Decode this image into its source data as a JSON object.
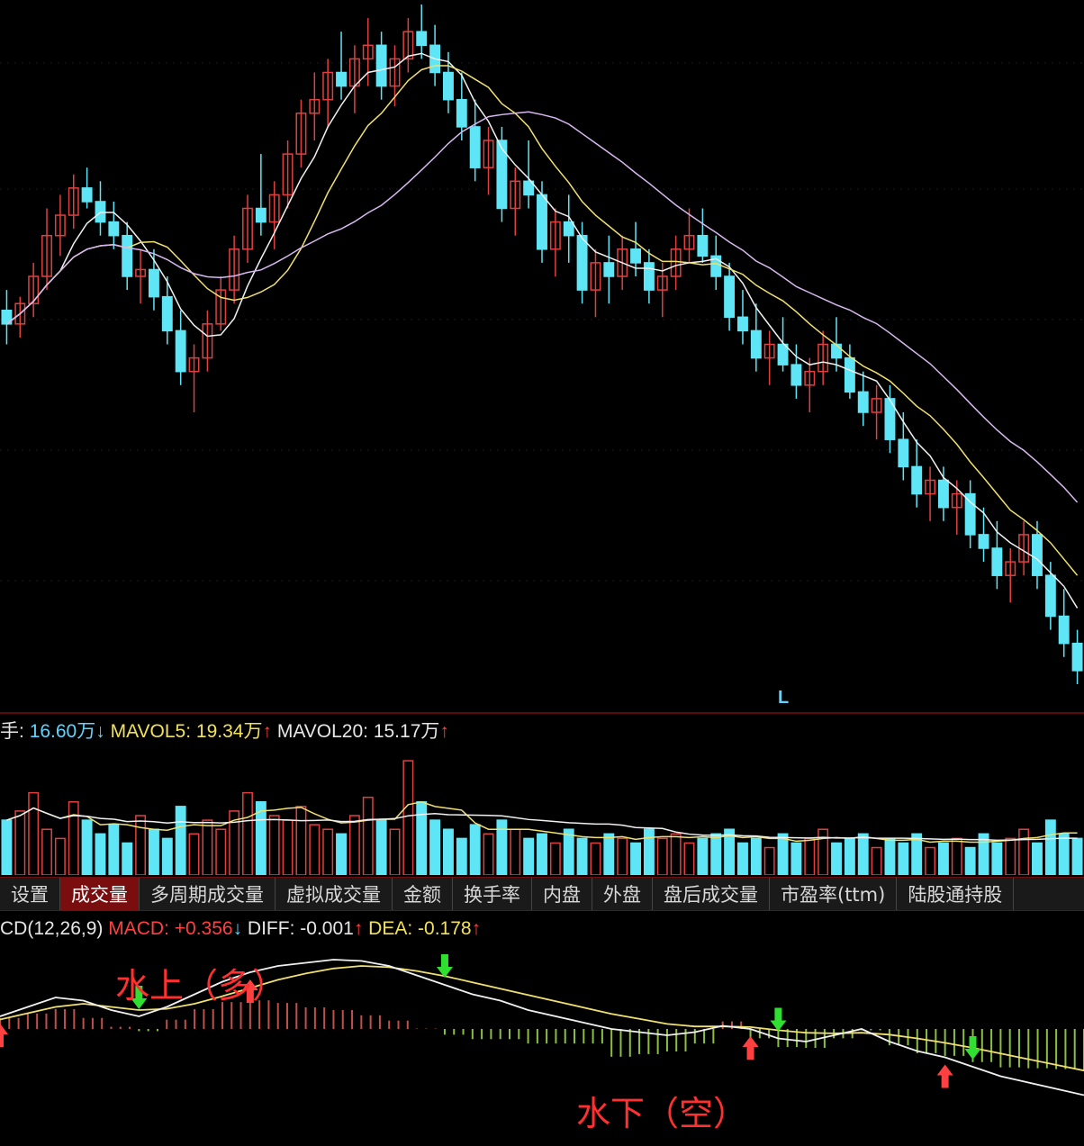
{
  "price_marker": "L",
  "volume_header": {
    "vol_label": "手:",
    "vol_value": "16.60万",
    "vol_arrow": "↓",
    "mavol5_label": "MAVOL5:",
    "mavol5_value": "19.34万",
    "mavol5_arrow": "↑",
    "mavol20_label": "MAVOL20:",
    "mavol20_value": "15.17万",
    "mavol20_arrow": "↑"
  },
  "tabs": [
    {
      "label": "设置",
      "active": false
    },
    {
      "label": "成交量",
      "active": true
    },
    {
      "label": "多周期成交量",
      "active": false
    },
    {
      "label": "虚拟成交量",
      "active": false
    },
    {
      "label": "金额",
      "active": false
    },
    {
      "label": "换手率",
      "active": false
    },
    {
      "label": "内盘",
      "active": false
    },
    {
      "label": "外盘",
      "active": false
    },
    {
      "label": "盘后成交量",
      "active": false
    },
    {
      "label": "市盈率(ttm)",
      "active": false
    },
    {
      "label": "陆股通持股",
      "active": false
    }
  ],
  "macd_header": {
    "name": "CD(12,26,9)",
    "macd_label": "MACD:",
    "macd_value": "+0.356",
    "macd_arrow": "↓",
    "diff_label": "DIFF:",
    "diff_value": "-0.001",
    "diff_arrow": "↑",
    "dea_label": "DEA:",
    "dea_value": "-0.178",
    "dea_arrow": "↑"
  },
  "annotations": {
    "above_water": "水上（多）",
    "below_water": "水下（空）"
  },
  "colors": {
    "up": "#e04040",
    "down": "#5ee6f6",
    "ma_white": "#f0f0f0",
    "ma_yellow": "#f0e070",
    "ma_purple": "#d8b8f0",
    "macd_pos": "#c0504a",
    "macd_neg": "#8ac040",
    "buy_arrow": "#ff4040",
    "sell_arrow": "#30e030"
  },
  "chart_data": [
    {
      "type": "candlestick",
      "description": "price",
      "ylim": [
        0,
        100
      ],
      "candles": [
        [
          55,
          58,
          50,
          53
        ],
        [
          53,
          57,
          51,
          56
        ],
        [
          56,
          62,
          54,
          60
        ],
        [
          60,
          70,
          58,
          66
        ],
        [
          66,
          72,
          63,
          69
        ],
        [
          69,
          75,
          67,
          73
        ],
        [
          73,
          76,
          70,
          71
        ],
        [
          71,
          74,
          66,
          68
        ],
        [
          68,
          71,
          64,
          66
        ],
        [
          66,
          68,
          58,
          60
        ],
        [
          60,
          64,
          56,
          61
        ],
        [
          61,
          64,
          55,
          57
        ],
        [
          57,
          60,
          50,
          52
        ],
        [
          52,
          55,
          44,
          46
        ],
        [
          46,
          50,
          40,
          48
        ],
        [
          48,
          55,
          46,
          53
        ],
        [
          53,
          60,
          52,
          58
        ],
        [
          58,
          66,
          56,
          64
        ],
        [
          64,
          72,
          62,
          70
        ],
        [
          70,
          78,
          66,
          68
        ],
        [
          68,
          74,
          64,
          72
        ],
        [
          72,
          80,
          70,
          78
        ],
        [
          78,
          86,
          76,
          84
        ],
        [
          84,
          90,
          80,
          86
        ],
        [
          86,
          92,
          82,
          90
        ],
        [
          90,
          96,
          86,
          88
        ],
        [
          88,
          94,
          84,
          92
        ],
        [
          92,
          98,
          88,
          94
        ],
        [
          94,
          96,
          86,
          88
        ],
        [
          88,
          94,
          85,
          92
        ],
        [
          92,
          98,
          90,
          96
        ],
        [
          96,
          100,
          92,
          94
        ],
        [
          94,
          97,
          88,
          90
        ],
        [
          90,
          93,
          84,
          86
        ],
        [
          86,
          90,
          80,
          82
        ],
        [
          82,
          86,
          74,
          76
        ],
        [
          76,
          82,
          72,
          80
        ],
        [
          80,
          82,
          68,
          70
        ],
        [
          70,
          76,
          66,
          74
        ],
        [
          74,
          80,
          70,
          72
        ],
        [
          72,
          74,
          62,
          64
        ],
        [
          64,
          70,
          60,
          68
        ],
        [
          68,
          72,
          62,
          66
        ],
        [
          66,
          68,
          56,
          58
        ],
        [
          58,
          64,
          54,
          62
        ],
        [
          62,
          66,
          56,
          60
        ],
        [
          60,
          66,
          58,
          64
        ],
        [
          64,
          68,
          60,
          62
        ],
        [
          62,
          64,
          56,
          58
        ],
        [
          58,
          62,
          54,
          60
        ],
        [
          60,
          66,
          58,
          64
        ],
        [
          64,
          70,
          62,
          66
        ],
        [
          66,
          70,
          62,
          63
        ],
        [
          63,
          66,
          58,
          60
        ],
        [
          60,
          62,
          52,
          54
        ],
        [
          54,
          58,
          50,
          52
        ],
        [
          52,
          56,
          46,
          48
        ],
        [
          48,
          52,
          44,
          50
        ],
        [
          50,
          54,
          46,
          47
        ],
        [
          47,
          50,
          42,
          44
        ],
        [
          44,
          48,
          40,
          46
        ],
        [
          46,
          52,
          44,
          50
        ],
        [
          50,
          54,
          46,
          48
        ],
        [
          48,
          50,
          42,
          43
        ],
        [
          43,
          46,
          38,
          40
        ],
        [
          40,
          44,
          36,
          42
        ],
        [
          42,
          44,
          34,
          36
        ],
        [
          36,
          40,
          30,
          32
        ],
        [
          32,
          36,
          26,
          28
        ],
        [
          28,
          32,
          24,
          30
        ],
        [
          30,
          32,
          24,
          26
        ],
        [
          26,
          30,
          22,
          28
        ],
        [
          28,
          30,
          20,
          22
        ],
        [
          22,
          26,
          18,
          20
        ],
        [
          20,
          24,
          14,
          16
        ],
        [
          16,
          20,
          12,
          18
        ],
        [
          18,
          24,
          16,
          22
        ],
        [
          22,
          24,
          14,
          16
        ],
        [
          16,
          18,
          8,
          10
        ],
        [
          10,
          14,
          4,
          6
        ],
        [
          6,
          8,
          0,
          2
        ]
      ]
    },
    {
      "type": "bar",
      "description": "volume",
      "values": [
        12,
        14,
        18,
        10,
        8,
        16,
        12,
        9,
        11,
        7,
        13,
        10,
        8,
        15,
        9,
        12,
        10,
        14,
        18,
        16,
        13,
        12,
        15,
        11,
        10,
        9,
        13,
        17,
        12,
        10,
        25,
        16,
        12,
        10,
        8,
        11,
        9,
        12,
        10,
        8,
        9,
        7,
        10,
        8,
        7,
        9,
        8,
        7,
        10,
        8,
        9,
        7,
        8,
        9,
        10,
        7,
        8,
        6,
        9,
        7,
        8,
        10,
        7,
        8,
        9,
        6,
        8,
        7,
        9,
        6,
        7,
        8,
        6,
        9,
        7,
        8,
        10,
        7,
        12,
        9,
        8
      ]
    },
    {
      "type": "line",
      "description": "macd",
      "diff": [
        0.2,
        0.35,
        0.5,
        0.45,
        0.3,
        0.2,
        0.35,
        0.55,
        0.75,
        0.9,
        1.0,
        1.05,
        1.1,
        1.08,
        1.0,
        0.85,
        0.7,
        0.55,
        0.45,
        0.3,
        0.2,
        0.1,
        0.0,
        -0.05,
        -0.1,
        -0.05,
        0.05,
        0.0,
        -0.15,
        -0.2,
        -0.1,
        0.0,
        -0.2,
        -0.35,
        -0.45,
        -0.6,
        -0.75,
        -0.85,
        -0.95,
        -1.05
      ],
      "dea": [
        0.15,
        0.25,
        0.35,
        0.4,
        0.35,
        0.3,
        0.32,
        0.4,
        0.52,
        0.65,
        0.78,
        0.88,
        0.96,
        1.0,
        0.98,
        0.92,
        0.84,
        0.74,
        0.64,
        0.54,
        0.44,
        0.34,
        0.24,
        0.16,
        0.08,
        0.04,
        0.04,
        0.03,
        -0.02,
        -0.06,
        -0.07,
        -0.06,
        -0.09,
        -0.15,
        -0.22,
        -0.3,
        -0.39,
        -0.48,
        -0.57,
        -0.66
      ],
      "buy_points": [
        0,
        9,
        27,
        34
      ],
      "sell_points": [
        5,
        16,
        28,
        35
      ]
    }
  ]
}
